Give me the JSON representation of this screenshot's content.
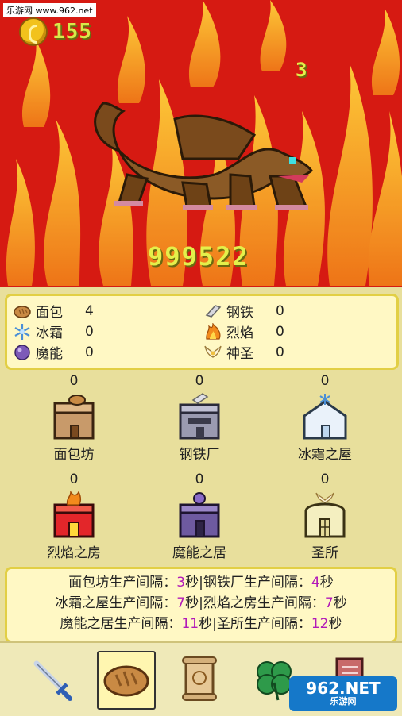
{
  "watermark": "乐游网 www.962.net",
  "hud": {
    "coins": "155",
    "damage_popup": "3",
    "enemy_hp": "999522"
  },
  "resources": [
    {
      "name": "面包",
      "value": "4"
    },
    {
      "name": "钢铁",
      "value": "0"
    },
    {
      "name": "冰霜",
      "value": "0"
    },
    {
      "name": "烈焰",
      "value": "0"
    },
    {
      "name": "魔能",
      "value": "0"
    },
    {
      "name": "神圣",
      "value": "0"
    }
  ],
  "buildings": [
    {
      "name": "面包坊",
      "count": "0"
    },
    {
      "name": "钢铁厂",
      "count": "0"
    },
    {
      "name": "冰霜之屋",
      "count": "0"
    },
    {
      "name": "烈焰之房",
      "count": "0"
    },
    {
      "name": "魔能之居",
      "count": "0"
    },
    {
      "name": "圣所",
      "count": "0"
    }
  ],
  "info": {
    "lines": [
      {
        "a": "面包坊生产间隔：",
        "n1": "3",
        "b": "秒|钢铁厂生产间隔：",
        "n2": "4",
        "c": "秒"
      },
      {
        "a": "冰霜之屋生产间隔：",
        "n1": "7",
        "b": "秒|烈焰之房生产间隔：",
        "n2": "7",
        "c": "秒"
      },
      {
        "a": "魔能之居生产间隔：",
        "n1": "11",
        "b": "秒|圣所生产间隔：",
        "n2": "12",
        "c": "秒"
      }
    ]
  },
  "tabs": [
    {
      "icon": "sword-icon"
    },
    {
      "icon": "bread-icon",
      "active": true
    },
    {
      "icon": "scroll-icon"
    },
    {
      "icon": "clover-icon"
    },
    {
      "icon": "book-icon"
    }
  ],
  "brand": {
    "logo": "962.NET",
    "sub": "乐游网"
  },
  "colors": {
    "fire_bg": "#d61a12",
    "panel": "#fff8c4",
    "panel_border": "#e2cf44",
    "highlight_number": "#b21ab8"
  }
}
